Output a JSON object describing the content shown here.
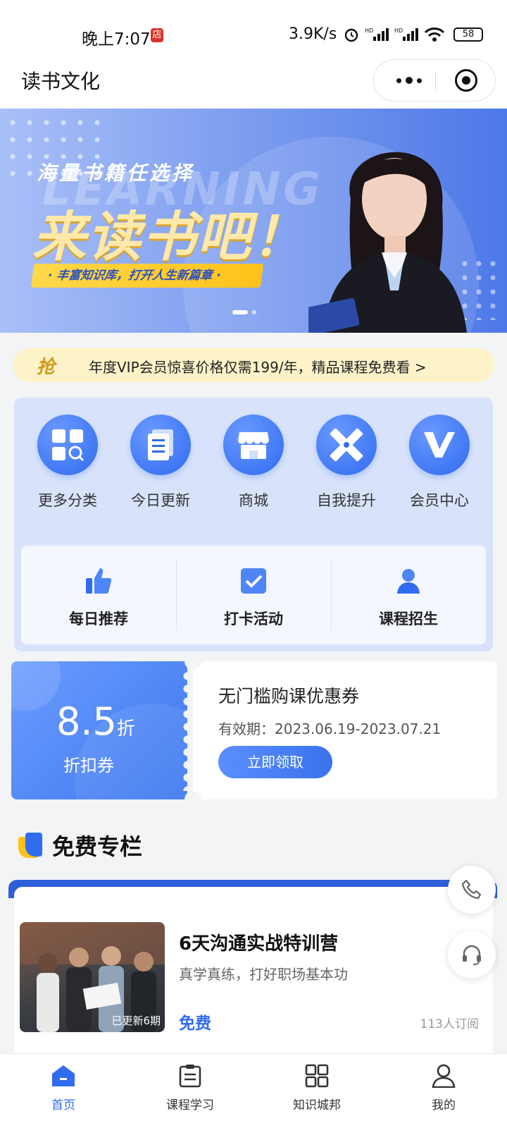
{
  "status": {
    "time": "晚上7:07",
    "badge": "店",
    "speed": "3.9K/s",
    "battery": "58"
  },
  "header": {
    "title": "读书文化"
  },
  "banner": {
    "subtitle": "海量书籍任选择",
    "headline": "来读书吧！",
    "watermark": "LEARNING",
    "ribbon": "· 丰富知识库，打开人生新篇章 ·"
  },
  "vip": {
    "icon_text": "抢",
    "text": "年度VIP会员惊喜价格仅需199/年，精品课程免费看 >"
  },
  "categories": [
    {
      "label": "更多分类",
      "icon": "grid-search-icon"
    },
    {
      "label": "今日更新",
      "icon": "document-icon"
    },
    {
      "label": "商城",
      "icon": "store-icon"
    },
    {
      "label": "自我提升",
      "icon": "ruler-pencil-icon"
    },
    {
      "label": "会员中心",
      "icon": "vip-icon"
    }
  ],
  "shortcuts": [
    {
      "label": "每日推荐",
      "icon": "thumbs-up-icon"
    },
    {
      "label": "打卡活动",
      "icon": "checkbox-icon"
    },
    {
      "label": "课程招生",
      "icon": "person-icon"
    }
  ],
  "coupon": {
    "rate": "8.5",
    "rate_unit": "折",
    "kind": "折扣券",
    "title": "无门槛购课优惠券",
    "validity": "有效期：2023.06.19-2023.07.21",
    "button": "立即领取"
  },
  "section": {
    "title": "免费专栏"
  },
  "course": {
    "thumb_tag": "已更新6期",
    "title": "6天沟通实战特训营",
    "desc": "真学真练，打好职场基本功",
    "price": "免费",
    "subscribers": "113人订阅"
  },
  "tabs": [
    {
      "label": "首页",
      "icon": "home-icon",
      "active": true
    },
    {
      "label": "课程学习",
      "icon": "clipboard-icon"
    },
    {
      "label": "知识城邦",
      "icon": "apps-grid-icon"
    },
    {
      "label": "我的",
      "icon": "user-icon"
    }
  ],
  "colors": {
    "accent": "#2f6cf0",
    "vip_bg": "#fdf3c8",
    "panel_bg": "#d8e3fb"
  }
}
